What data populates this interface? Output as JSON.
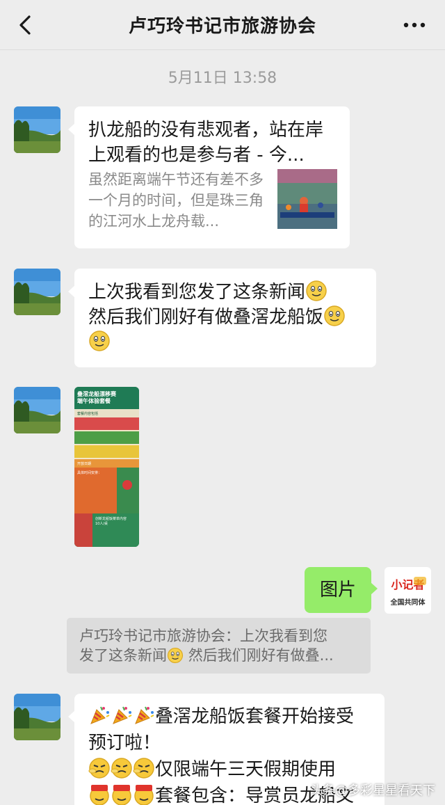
{
  "header": {
    "title": "卢巧玲书记市旅游协会",
    "back_icon": "chevron-left-icon",
    "more_icon": "more-dots-icon"
  },
  "timestamp": "5月11日 13:58",
  "messages": {
    "link_card": {
      "title": "扒龙船的没有悲观者，站在岸上观看的也是参与者 - 今...",
      "desc": "虽然距离端午节还有差不多一个月的时间，但是珠三角的江河水上龙舟载..."
    },
    "text1": {
      "line1": "上次我看到您发了这条新闻",
      "line2": "然后我们刚好有做叠滘龙船饭"
    },
    "poster": {
      "title_line1": "叠滘龙船漂移赛",
      "title_line2": "端午体验套餐",
      "section1": "套餐内容包括",
      "section2": "开放日期",
      "section3": "具体时间安排：",
      "section4": "创新龙船饭菜单内容",
      "section5": "10人/桌"
    },
    "my_reply": {
      "text": "图片",
      "avatar_line1": "小记者",
      "avatar_line2": "全国共同体"
    },
    "quote": {
      "line1": "卢巧玲书记市旅游协会：上次我看到您",
      "line2_a": "发了这条新闻",
      "line2_b": "然后我们刚好有做叠..."
    },
    "text2": {
      "line1": "叠滘龙船饭套餐开始接受",
      "line2": "预订啦！",
      "line3": "仅限端午三天假期使用",
      "line4": "套餐包含：导赏员龙船文"
    }
  },
  "watermark": "头条@多彩星星看天下",
  "colors": {
    "background": "#ededed",
    "bubble_white": "#ffffff",
    "bubble_green": "#95ec69",
    "quote_bg": "#dcdcdc"
  }
}
